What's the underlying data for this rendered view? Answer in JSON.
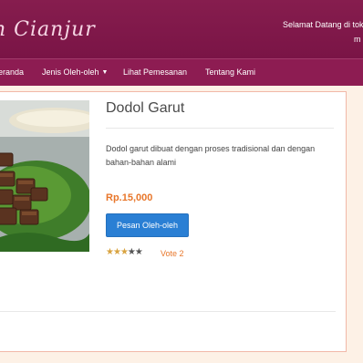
{
  "header": {
    "site_title": "n Cianjur",
    "welcome_line1": "Selamat Datang di tok",
    "welcome_line2": "m"
  },
  "nav": {
    "items": [
      {
        "label": "eranda"
      },
      {
        "label": "Jenis Oleh-oleh",
        "has_dropdown": true
      },
      {
        "label": "Lihat Pemesanan"
      },
      {
        "label": "Tentang Kami"
      }
    ]
  },
  "product": {
    "name": "Dodol Garut",
    "description": "Dodol garut dibuat dengan proses tradisional dan dengan bahan-bahan alami",
    "price": "Rp.15,000",
    "order_button": "Pesan Oleh-oleh",
    "rating": 3,
    "rating_max": 5,
    "vote_text": "Vote 2",
    "image_icon": "food-photo-icon"
  },
  "colors": {
    "header_bg": "#861d4e",
    "nav_bg": "#8d1c52",
    "accent_orange": "#e8762a",
    "button_blue": "#2a7fd4",
    "page_bg": "#fdf1e6"
  }
}
